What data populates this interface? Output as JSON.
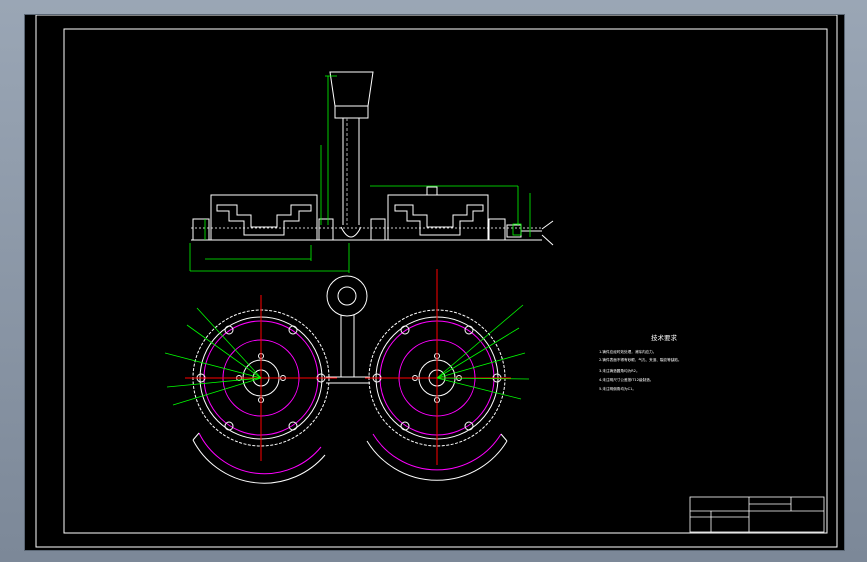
{
  "drawing": {
    "tech_title": "技术要求",
    "notes": [
      "1.铸件应经时效处理，消除内应力。",
      "2.铸件表面不得有砂眼、气孔、夹渣、裂纹等缺陷。",
      "3.未注铸造圆角均为R2。",
      "4.未注明尺寸公差按IT12级制造。",
      "5.未注明倒角均为C1。"
    ]
  },
  "colors": {
    "outline": "#ffffff",
    "dimension": "#00ff00",
    "centerline": "#ff0000",
    "circle": "#ff00ff",
    "hidden": "#0000ff"
  }
}
